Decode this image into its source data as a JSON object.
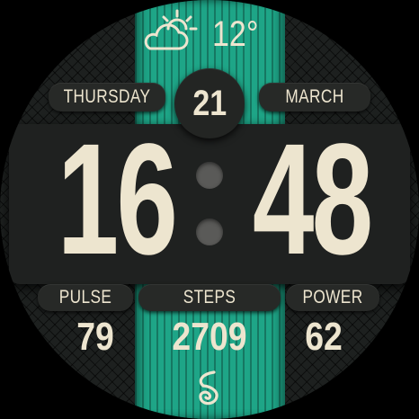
{
  "weather": {
    "icon": "partly-sunny-cloud-icon",
    "temperature": "12°"
  },
  "date": {
    "weekday": "THURSDAY",
    "day": "21",
    "month": "MARCH"
  },
  "time": {
    "hours": "16",
    "minutes": "48"
  },
  "metrics": [
    {
      "label": "PULSE",
      "value": "79"
    },
    {
      "label": "STEPS",
      "value": "2709"
    },
    {
      "label": "POWER",
      "value": "62"
    }
  ],
  "brand": {
    "icon": "spiral-logo-icon"
  },
  "colors": {
    "accent_stripe": "#1ea587",
    "text": "#ede5cf",
    "panel": "#1f2120",
    "background": "#1d201f"
  }
}
